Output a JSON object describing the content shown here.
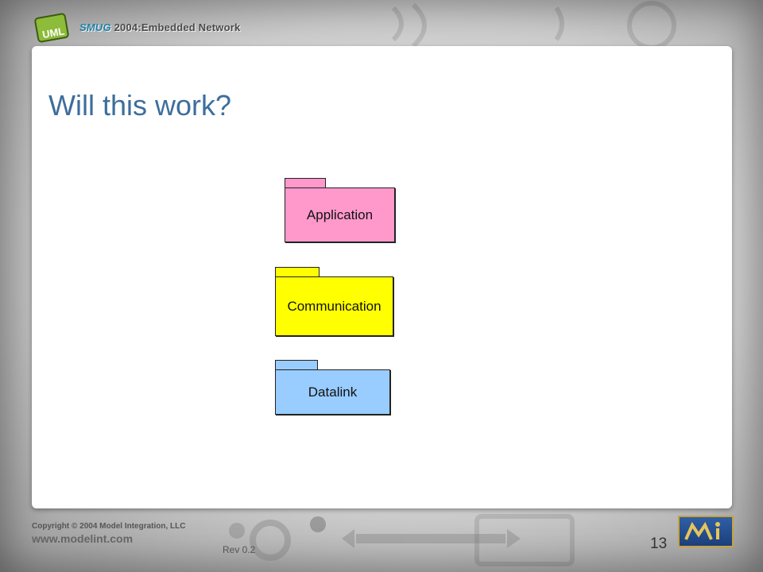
{
  "header": {
    "brand": "SMUG",
    "title_rest": "2004:Embedded Network"
  },
  "slide": {
    "title": "Will this work?"
  },
  "diagram": {
    "packages": [
      {
        "label": "Application",
        "color": "#ff99cc"
      },
      {
        "label": "Communication",
        "color": "#ffff00"
      },
      {
        "label": "Datalink",
        "color": "#99ccff"
      }
    ]
  },
  "footer": {
    "copyright": "Copyright © 2004 Model Integration, LLC",
    "website": "www.modelint.com",
    "revision": "Rev 0.2",
    "page_number": "13"
  },
  "icons": [
    "uml-logo-icon",
    "gear-icon",
    "arrow-icon",
    "mi-logo-icon"
  ]
}
